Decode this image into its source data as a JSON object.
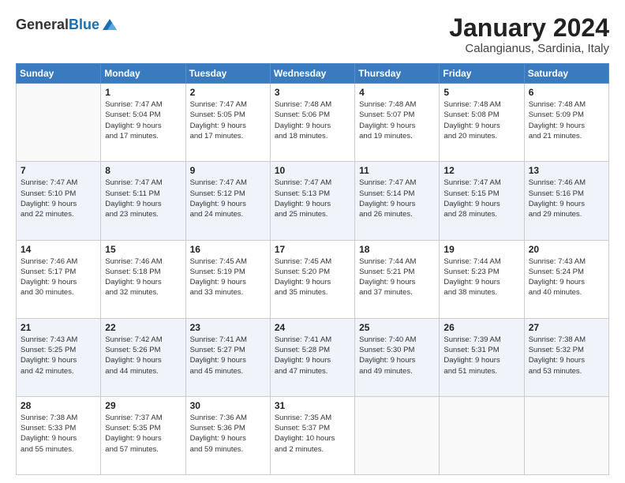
{
  "header": {
    "logo_general": "General",
    "logo_blue": "Blue",
    "month_title": "January 2024",
    "location": "Calangianus, Sardinia, Italy"
  },
  "weekdays": [
    "Sunday",
    "Monday",
    "Tuesday",
    "Wednesday",
    "Thursday",
    "Friday",
    "Saturday"
  ],
  "weeks": [
    [
      {
        "day": "",
        "empty": true
      },
      {
        "day": "1",
        "sunrise": "Sunrise: 7:47 AM",
        "sunset": "Sunset: 5:04 PM",
        "daylight": "Daylight: 9 hours and 17 minutes."
      },
      {
        "day": "2",
        "sunrise": "Sunrise: 7:47 AM",
        "sunset": "Sunset: 5:05 PM",
        "daylight": "Daylight: 9 hours and 17 minutes."
      },
      {
        "day": "3",
        "sunrise": "Sunrise: 7:48 AM",
        "sunset": "Sunset: 5:06 PM",
        "daylight": "Daylight: 9 hours and 18 minutes."
      },
      {
        "day": "4",
        "sunrise": "Sunrise: 7:48 AM",
        "sunset": "Sunset: 5:07 PM",
        "daylight": "Daylight: 9 hours and 19 minutes."
      },
      {
        "day": "5",
        "sunrise": "Sunrise: 7:48 AM",
        "sunset": "Sunset: 5:08 PM",
        "daylight": "Daylight: 9 hours and 20 minutes."
      },
      {
        "day": "6",
        "sunrise": "Sunrise: 7:48 AM",
        "sunset": "Sunset: 5:09 PM",
        "daylight": "Daylight: 9 hours and 21 minutes."
      }
    ],
    [
      {
        "day": "7",
        "sunrise": "Sunrise: 7:47 AM",
        "sunset": "Sunset: 5:10 PM",
        "daylight": "Daylight: 9 hours and 22 minutes."
      },
      {
        "day": "8",
        "sunrise": "Sunrise: 7:47 AM",
        "sunset": "Sunset: 5:11 PM",
        "daylight": "Daylight: 9 hours and 23 minutes."
      },
      {
        "day": "9",
        "sunrise": "Sunrise: 7:47 AM",
        "sunset": "Sunset: 5:12 PM",
        "daylight": "Daylight: 9 hours and 24 minutes."
      },
      {
        "day": "10",
        "sunrise": "Sunrise: 7:47 AM",
        "sunset": "Sunset: 5:13 PM",
        "daylight": "Daylight: 9 hours and 25 minutes."
      },
      {
        "day": "11",
        "sunrise": "Sunrise: 7:47 AM",
        "sunset": "Sunset: 5:14 PM",
        "daylight": "Daylight: 9 hours and 26 minutes."
      },
      {
        "day": "12",
        "sunrise": "Sunrise: 7:47 AM",
        "sunset": "Sunset: 5:15 PM",
        "daylight": "Daylight: 9 hours and 28 minutes."
      },
      {
        "day": "13",
        "sunrise": "Sunrise: 7:46 AM",
        "sunset": "Sunset: 5:16 PM",
        "daylight": "Daylight: 9 hours and 29 minutes."
      }
    ],
    [
      {
        "day": "14",
        "sunrise": "Sunrise: 7:46 AM",
        "sunset": "Sunset: 5:17 PM",
        "daylight": "Daylight: 9 hours and 30 minutes."
      },
      {
        "day": "15",
        "sunrise": "Sunrise: 7:46 AM",
        "sunset": "Sunset: 5:18 PM",
        "daylight": "Daylight: 9 hours and 32 minutes."
      },
      {
        "day": "16",
        "sunrise": "Sunrise: 7:45 AM",
        "sunset": "Sunset: 5:19 PM",
        "daylight": "Daylight: 9 hours and 33 minutes."
      },
      {
        "day": "17",
        "sunrise": "Sunrise: 7:45 AM",
        "sunset": "Sunset: 5:20 PM",
        "daylight": "Daylight: 9 hours and 35 minutes."
      },
      {
        "day": "18",
        "sunrise": "Sunrise: 7:44 AM",
        "sunset": "Sunset: 5:21 PM",
        "daylight": "Daylight: 9 hours and 37 minutes."
      },
      {
        "day": "19",
        "sunrise": "Sunrise: 7:44 AM",
        "sunset": "Sunset: 5:23 PM",
        "daylight": "Daylight: 9 hours and 38 minutes."
      },
      {
        "day": "20",
        "sunrise": "Sunrise: 7:43 AM",
        "sunset": "Sunset: 5:24 PM",
        "daylight": "Daylight: 9 hours and 40 minutes."
      }
    ],
    [
      {
        "day": "21",
        "sunrise": "Sunrise: 7:43 AM",
        "sunset": "Sunset: 5:25 PM",
        "daylight": "Daylight: 9 hours and 42 minutes."
      },
      {
        "day": "22",
        "sunrise": "Sunrise: 7:42 AM",
        "sunset": "Sunset: 5:26 PM",
        "daylight": "Daylight: 9 hours and 44 minutes."
      },
      {
        "day": "23",
        "sunrise": "Sunrise: 7:41 AM",
        "sunset": "Sunset: 5:27 PM",
        "daylight": "Daylight: 9 hours and 45 minutes."
      },
      {
        "day": "24",
        "sunrise": "Sunrise: 7:41 AM",
        "sunset": "Sunset: 5:28 PM",
        "daylight": "Daylight: 9 hours and 47 minutes."
      },
      {
        "day": "25",
        "sunrise": "Sunrise: 7:40 AM",
        "sunset": "Sunset: 5:30 PM",
        "daylight": "Daylight: 9 hours and 49 minutes."
      },
      {
        "day": "26",
        "sunrise": "Sunrise: 7:39 AM",
        "sunset": "Sunset: 5:31 PM",
        "daylight": "Daylight: 9 hours and 51 minutes."
      },
      {
        "day": "27",
        "sunrise": "Sunrise: 7:38 AM",
        "sunset": "Sunset: 5:32 PM",
        "daylight": "Daylight: 9 hours and 53 minutes."
      }
    ],
    [
      {
        "day": "28",
        "sunrise": "Sunrise: 7:38 AM",
        "sunset": "Sunset: 5:33 PM",
        "daylight": "Daylight: 9 hours and 55 minutes."
      },
      {
        "day": "29",
        "sunrise": "Sunrise: 7:37 AM",
        "sunset": "Sunset: 5:35 PM",
        "daylight": "Daylight: 9 hours and 57 minutes."
      },
      {
        "day": "30",
        "sunrise": "Sunrise: 7:36 AM",
        "sunset": "Sunset: 5:36 PM",
        "daylight": "Daylight: 9 hours and 59 minutes."
      },
      {
        "day": "31",
        "sunrise": "Sunrise: 7:35 AM",
        "sunset": "Sunset: 5:37 PM",
        "daylight": "Daylight: 10 hours and 2 minutes."
      },
      {
        "day": "",
        "empty": true
      },
      {
        "day": "",
        "empty": true
      },
      {
        "day": "",
        "empty": true
      }
    ]
  ]
}
